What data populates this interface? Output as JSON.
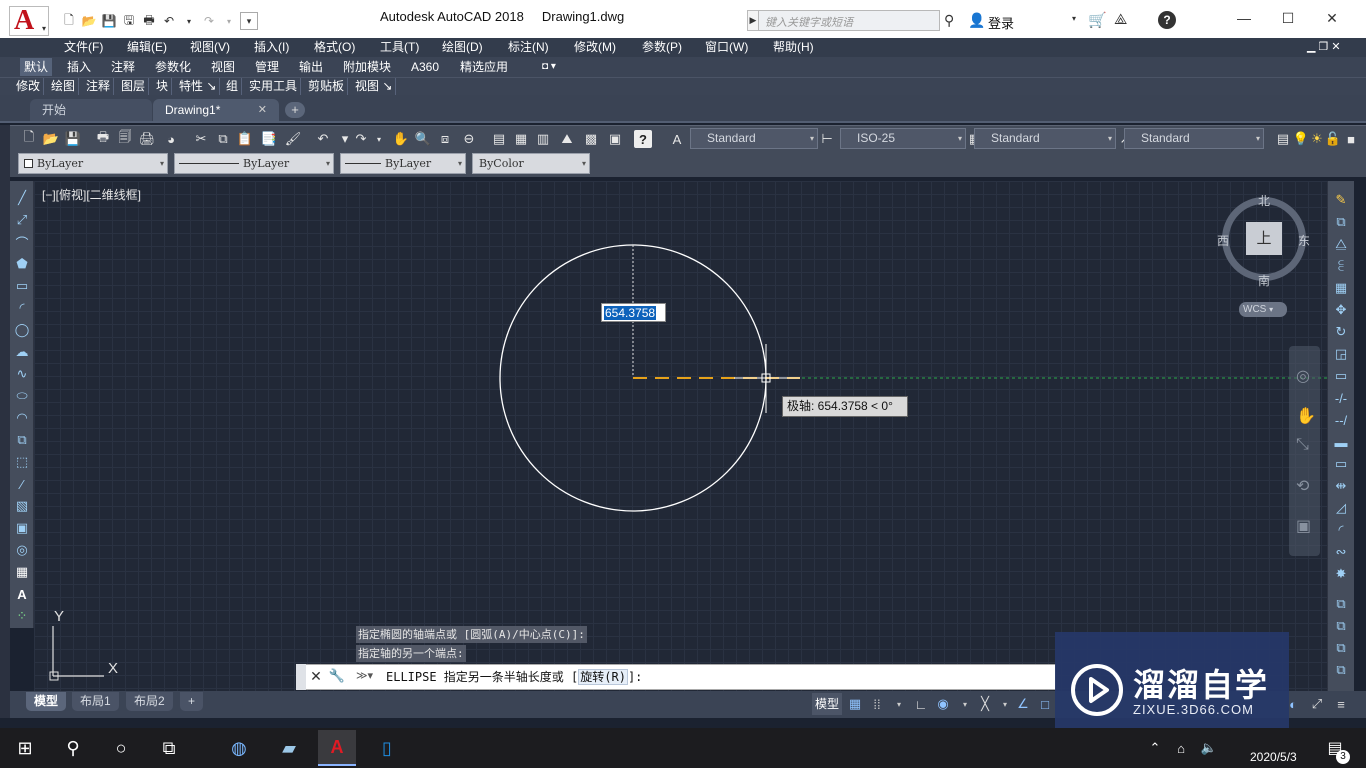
{
  "window": {
    "title": "Autodesk AutoCAD 2018     Drawing1.dwg",
    "search_placeholder": "键入关键字或短语",
    "login_label": "登录"
  },
  "menu": [
    "文件(F)",
    "编辑(E)",
    "视图(V)",
    "插入(I)",
    "格式(O)",
    "工具(T)",
    "绘图(D)",
    "标注(N)",
    "修改(M)",
    "参数(P)",
    "窗口(W)",
    "帮助(H)"
  ],
  "ribbon_tabs": [
    "默认",
    "插入",
    "注释",
    "参数化",
    "视图",
    "管理",
    "输出",
    "附加模块",
    "A360",
    "精选应用"
  ],
  "ribbon_panels": [
    "修改",
    "绘图",
    "注释",
    "图层",
    "块",
    "特性 ↘",
    "组",
    "实用工具",
    "剪贴板",
    "视图 ↘"
  ],
  "file_tabs": {
    "start": "开始",
    "drawing": "Drawing1*"
  },
  "styles": {
    "text_style": "Standard",
    "dim_style": "ISO-25",
    "table_style": "Standard",
    "mleader_style": "Standard"
  },
  "properties": {
    "layer": "ByLayer",
    "linetype": "ByLayer",
    "lineweight": "ByLayer",
    "color": "ByColor"
  },
  "viewport": {
    "label": "[−][俯视][二维线框]"
  },
  "viewcube": {
    "north": "北",
    "south": "南",
    "east": "东",
    "west": "西",
    "top": "上",
    "wcs": "WCS"
  },
  "ucs": {
    "x_label": "X",
    "y_label": "Y"
  },
  "dynamic_input": {
    "value": "654.3758"
  },
  "polar_tooltip": "极轴: 654.3758 < 0°",
  "command": {
    "history_1": "指定椭圆的轴端点或 [圆弧(A)/中心点(C)]:",
    "history_2": "指定轴的另一个端点:",
    "prompt": "ELLIPSE 指定另一条半轴长度或 [",
    "option": "旋转(R)",
    "prompt_end": "]:"
  },
  "layout_tabs": [
    "模型",
    "布局1",
    "布局2"
  ],
  "status": {
    "model_label": "模型"
  },
  "watermark": {
    "title": "溜溜自学",
    "url": "ZIXUE.3D66.COM"
  },
  "taskbar": {
    "date": "2020/5/3",
    "notification_count": "3"
  },
  "colors": {
    "canvas": "#212836",
    "circle": "#ffffff",
    "polar_track": "#2aa84a",
    "axis_dash": "#e6a21a"
  }
}
